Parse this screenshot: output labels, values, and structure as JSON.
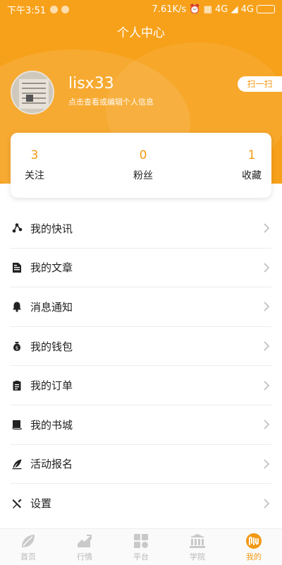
{
  "status_bar": {
    "time": "下午3:51",
    "right_text": "7.61K/s ⏰ ▦ 4G ◢ 4G",
    "battery_color": "#7ed957"
  },
  "header": {
    "title": "个人中心",
    "username": "lisx33",
    "subtitle": "点击查看或编辑个人信息",
    "scan_label": "扫一扫",
    "bg_color": "#f7a11a"
  },
  "stats": [
    {
      "value": "3",
      "label": "关注"
    },
    {
      "value": "0",
      "label": "粉丝"
    },
    {
      "value": "1",
      "label": "收藏"
    }
  ],
  "menu": [
    {
      "label": "我的快讯",
      "icon": "share-icon"
    },
    {
      "label": "我的文章",
      "icon": "article-icon"
    },
    {
      "label": "消息通知",
      "icon": "bell-icon"
    },
    {
      "label": "我的钱包",
      "icon": "money-bag-icon"
    },
    {
      "label": "我的订单",
      "icon": "clipboard-icon"
    },
    {
      "label": "我的书城",
      "icon": "book-icon"
    },
    {
      "label": "活动报名",
      "icon": "pen-icon"
    },
    {
      "label": "设置",
      "icon": "tools-icon"
    }
  ],
  "tabs": [
    {
      "label": "首页",
      "icon": "leaf-icon",
      "active": false
    },
    {
      "label": "行情",
      "icon": "trend-icon",
      "active": false
    },
    {
      "label": "平台",
      "icon": "grid-icon",
      "active": false
    },
    {
      "label": "学院",
      "icon": "bank-icon",
      "active": false
    },
    {
      "label": "我的",
      "icon": "profile-logo-icon",
      "active": true
    }
  ],
  "accent_color": "#f29a14"
}
